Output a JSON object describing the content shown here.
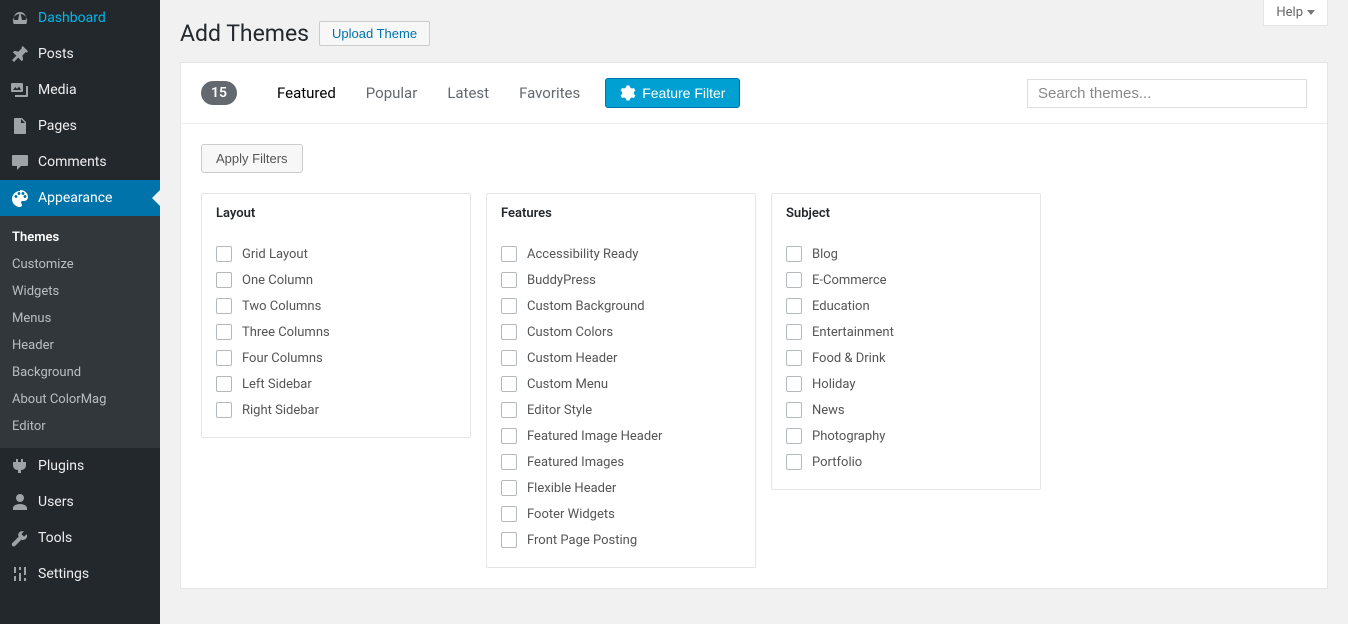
{
  "help": "Help",
  "sidebar": {
    "items": [
      {
        "label": "Dashboard",
        "icon": "dashboard"
      },
      {
        "label": "Posts",
        "icon": "pin"
      },
      {
        "label": "Media",
        "icon": "media"
      },
      {
        "label": "Pages",
        "icon": "pages"
      },
      {
        "label": "Comments",
        "icon": "comments"
      },
      {
        "label": "Appearance",
        "icon": "appearance",
        "current": true
      },
      {
        "label": "Plugins",
        "icon": "plugins"
      },
      {
        "label": "Users",
        "icon": "users"
      },
      {
        "label": "Tools",
        "icon": "tools"
      },
      {
        "label": "Settings",
        "icon": "settings"
      }
    ],
    "submenu": [
      "Themes",
      "Customize",
      "Widgets",
      "Menus",
      "Header",
      "Background",
      "About ColorMag",
      "Editor"
    ]
  },
  "header": {
    "title": "Add Themes",
    "upload": "Upload Theme"
  },
  "filterbar": {
    "count": "15",
    "links": [
      "Featured",
      "Popular",
      "Latest",
      "Favorites"
    ],
    "feature_filter": "Feature Filter",
    "search_placeholder": "Search themes..."
  },
  "apply": "Apply Filters",
  "filters": {
    "layout": {
      "title": "Layout",
      "items": [
        "Grid Layout",
        "One Column",
        "Two Columns",
        "Three Columns",
        "Four Columns",
        "Left Sidebar",
        "Right Sidebar"
      ]
    },
    "features": {
      "title": "Features",
      "items": [
        "Accessibility Ready",
        "BuddyPress",
        "Custom Background",
        "Custom Colors",
        "Custom Header",
        "Custom Menu",
        "Editor Style",
        "Featured Image Header",
        "Featured Images",
        "Flexible Header",
        "Footer Widgets",
        "Front Page Posting"
      ]
    },
    "subject": {
      "title": "Subject",
      "items": [
        "Blog",
        "E-Commerce",
        "Education",
        "Entertainment",
        "Food & Drink",
        "Holiday",
        "News",
        "Photography",
        "Portfolio"
      ]
    }
  }
}
